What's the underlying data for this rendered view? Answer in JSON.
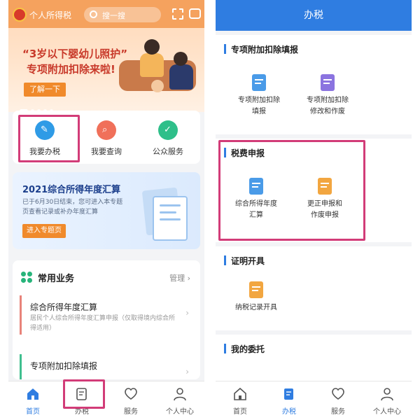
{
  "left": {
    "app_title": "个人所得税",
    "search_placeholder": "搜一搜",
    "banner": {
      "line1": "“3岁以下婴幼儿照护”",
      "line2": "专项附加扣除来啦!",
      "button": "了解一下"
    },
    "quick_actions": [
      {
        "label": "我要办税",
        "icon": "pen-icon",
        "color": "#2f9be6"
      },
      {
        "label": "我要查询",
        "icon": "search-icon",
        "color": "#f0705a"
      },
      {
        "label": "公众服务",
        "icon": "shield-icon",
        "color": "#2fbf8a"
      }
    ],
    "annual_card": {
      "title": "2021综合所得年度汇算",
      "desc": "已于6月30日结束，您可进入本专题页查看记录或补办年度汇算",
      "button": "进入专题页"
    },
    "common": {
      "title": "常用业务",
      "manage": "管理",
      "items": [
        {
          "title": "综合所得年度汇算",
          "desc": "居民个人综合所得年度汇算申报（仅取得境内综合所得适用）"
        },
        {
          "title": "专项附加扣除填报",
          "desc": ""
        }
      ]
    },
    "tabs": [
      {
        "label": "首页",
        "icon": "home-icon"
      },
      {
        "label": "办税",
        "icon": "tax-doc-icon"
      },
      {
        "label": "服务",
        "icon": "service-heart-icon"
      },
      {
        "label": "个人中心",
        "icon": "person-icon"
      }
    ],
    "active_tab": 0
  },
  "right": {
    "header": "办税",
    "sections": [
      {
        "title": "专项附加扣除填报",
        "items": [
          {
            "line1": "专项附加扣除",
            "line2": "填报",
            "color": "#4a9be8"
          },
          {
            "line1": "专项附加扣除",
            "line2": "修改和作废",
            "color": "#8b74e0"
          }
        ]
      },
      {
        "title": "税费申报",
        "items": [
          {
            "line1": "综合所得年度",
            "line2": "汇算",
            "color": "#4a9be8"
          },
          {
            "line1": "更正申报和",
            "line2": "作废申报",
            "color": "#f2a640"
          }
        ]
      },
      {
        "title": "证明开具",
        "items": [
          {
            "line1": "纳税记录开具",
            "line2": "",
            "color": "#f2a640"
          }
        ]
      },
      {
        "title": "我的委托",
        "items": []
      }
    ],
    "tabs": [
      {
        "label": "首页",
        "icon": "home-icon"
      },
      {
        "label": "办税",
        "icon": "tax-doc-icon"
      },
      {
        "label": "服务",
        "icon": "service-heart-icon"
      },
      {
        "label": "个人中心",
        "icon": "person-icon"
      }
    ],
    "active_tab": 1
  },
  "colors": {
    "accent_blue": "#2f7de1",
    "highlight": "#d23c78",
    "orange": "#f08a2b"
  }
}
